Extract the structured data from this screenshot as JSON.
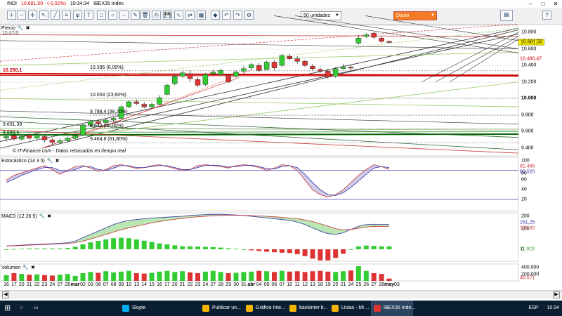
{
  "titlebar": {
    "symbol": "INDI",
    "price": "10.681,50",
    "change": "(-0,02%)",
    "time": "10:34:34",
    "name": "IBEX35 Index"
  },
  "toolbar": {
    "units_label": "50 unidades",
    "period_label": "Diario"
  },
  "price_panel": {
    "label": "Precio",
    "top_value": "10.67/9",
    "credit": "IT-Finance.com",
    "credit_sub": "Datos retrasados en tiempo real",
    "yticks": [
      "10.800",
      "10.600",
      "10.400",
      "10.200",
      "10.000",
      "9.800",
      "9.600",
      "9.400"
    ],
    "badge_current": "10.681,50",
    "badge_second": "10.480,47",
    "left_levels": [
      "10.250,1",
      "9.631,39",
      "9.680,5"
    ],
    "fib": [
      "10.335 (0,00%)",
      "10.003 (23,60%)",
      "9.798,4 (38,20%)",
      "9.632 (50,00%)",
      "9.464,8 (61,80%)"
    ]
  },
  "stoch_panel": {
    "label": "Estocástico (14 3 5)",
    "yticks": [
      "100",
      "80",
      "60",
      "40",
      "20"
    ],
    "values": [
      "81,485",
      "80,520"
    ]
  },
  "macd_panel": {
    "label": "MACD (12 26 9)",
    "yticks": [
      "200",
      "100",
      "0"
    ],
    "values": [
      "151,25",
      "139,32",
      "11,923"
    ]
  },
  "volume_panel": {
    "label": "Volumen",
    "yticks": [
      "400.000",
      "200.000"
    ],
    "values": [
      "46.671"
    ]
  },
  "xaxis": [
    "16",
    "17",
    "20",
    "21",
    "22",
    "23",
    "24",
    "27",
    "28",
    "mar",
    "02",
    "03",
    "06",
    "07",
    "08",
    "09",
    "10",
    "13",
    "14",
    "15",
    "16",
    "17",
    "20",
    "21",
    "22",
    "23",
    "24",
    "27",
    "28",
    "29",
    "30",
    "31",
    "abr",
    "04",
    "05",
    "06",
    "07",
    "10",
    "11",
    "12",
    "13",
    "18",
    "19",
    "20",
    "21",
    "24",
    "25",
    "26",
    "27",
    "28",
    "may",
    "03"
  ],
  "xaxis_bold": [
    "mar",
    "abr",
    "may"
  ],
  "taskbar": {
    "items": [
      "Skype",
      "Publicar un...",
      "Gráfico Inte...",
      "bankinter b...",
      "Listas - Mi ...",
      "IBEX35 Inde..."
    ],
    "lang": "ESP",
    "clock": "10:34"
  }
}
